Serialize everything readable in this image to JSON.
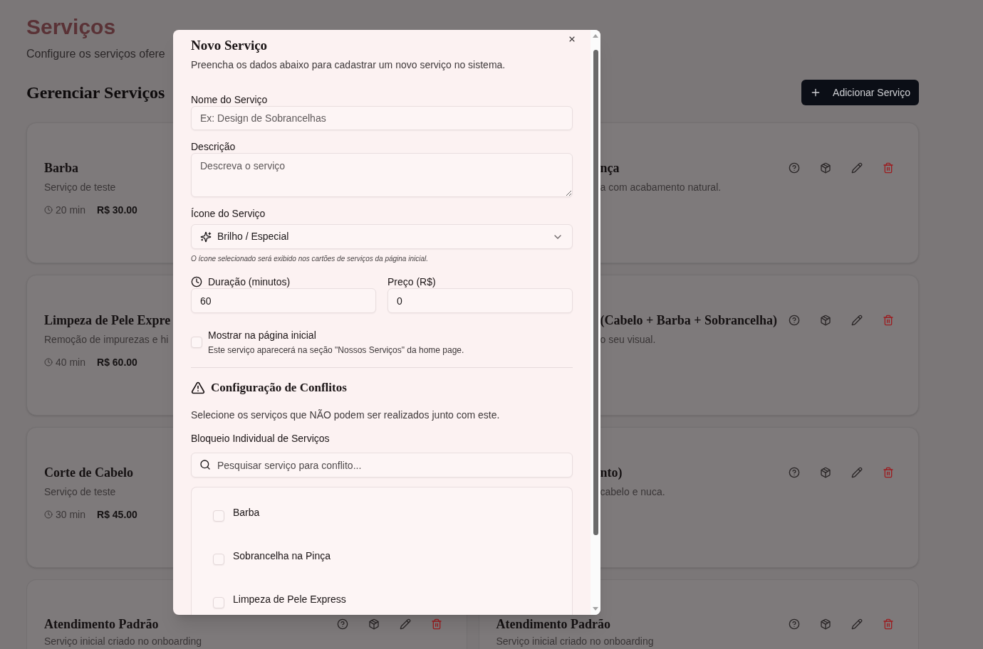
{
  "page": {
    "title": "Serviços",
    "subtitle": "Configure os serviços ofere",
    "section_title": "Gerenciar Serviços",
    "add_button": {
      "label": "Adicionar Serviço"
    }
  },
  "service_cards": [
    {
      "title": "Barba",
      "description": "Serviço de teste",
      "duration": "20 min",
      "price": "R$ 30.00"
    },
    {
      "title": "nça",
      "description": "a com acabamento natural."
    },
    {
      "title": "Limpeza de Pele Expre",
      "description": "Remoção de impurezas e hi",
      "duration": "40 min",
      "price": "R$ 60.00"
    },
    {
      "title": "(Cabelo + Barba + Sobrancelha)",
      "description": "o seu visual."
    },
    {
      "title": "Corte de Cabelo",
      "description": "Serviço de teste",
      "duration": "30 min",
      "price": "R$ 45.00"
    },
    {
      "title": "nto)",
      "description": "cabelo e nuca."
    },
    {
      "title": "Atendimento Padrão",
      "description": "Serviço inicial criado no onboarding"
    },
    {
      "title": "Atendimento Padrão",
      "description": "Serviço inicial criado no onboarding"
    }
  ],
  "dialog": {
    "title": "Novo Serviço",
    "description": "Preencha os dados abaixo para cadastrar um novo serviço no sistema.",
    "fields": [
      {
        "kind": "text",
        "label": "Nome do Serviço",
        "placeholder": "Ex: Design de Sobrancelhas"
      },
      {
        "kind": "textarea",
        "label": "Descrição",
        "placeholder": "Descreva o serviço"
      },
      {
        "kind": "select",
        "label": "Ícone do Serviço",
        "value": "Brilho / Especial",
        "hint": "O ícone selecionado será exibido nos cartões de serviços da página inicial."
      }
    ],
    "duration": {
      "label": "Duração (minutos)",
      "value": "60"
    },
    "price": {
      "label": "Preço (R$)",
      "value": "0"
    },
    "show_on_home": {
      "label": "Mostrar na página inicial",
      "description": "Este serviço aparecerá na seção \"Nossos Serviços\" da home page.",
      "checked": false
    },
    "conflicts": {
      "title": "Configuração de Conflitos",
      "description": "Selecione os serviços que NÃO podem ser realizados junto com este.",
      "label": "Bloqueio Individual de Serviços",
      "search": {
        "placeholder": "Pesquisar serviço para conflito..."
      },
      "services": [
        {
          "name": "Barba",
          "checked": false
        },
        {
          "name": "Sobrancelha na Pinça",
          "checked": false
        },
        {
          "name": "Limpeza de Pele Express",
          "checked": false
        }
      ]
    }
  }
}
